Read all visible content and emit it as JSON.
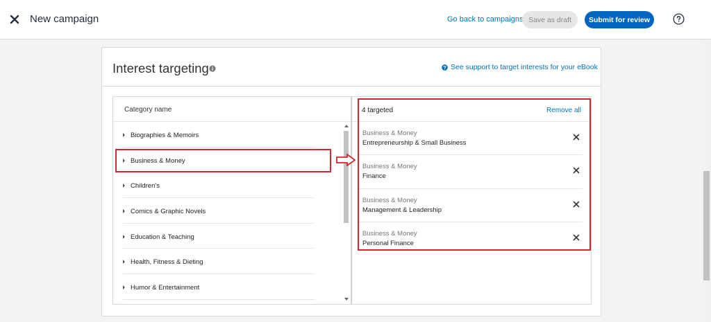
{
  "header": {
    "title": "New campaign",
    "back_link": "Go back to campaigns",
    "save_draft": "Save as draft",
    "submit": "Submit for review"
  },
  "card": {
    "title": "Interest targeting",
    "support_link": "See support to target interests for your eBook"
  },
  "categories": {
    "header": "Category name",
    "items": [
      "Biographies & Memoirs",
      "Business & Money",
      "Children's",
      "Comics & Graphic Novels",
      "Education & Teaching",
      "Health, Fitness & Dieting",
      "Humor & Entertainment"
    ]
  },
  "targeted": {
    "count_label": "4 targeted",
    "remove_all": "Remove all",
    "items": [
      {
        "parent": "Business & Money",
        "name": "Entrepreneurship & Small Business"
      },
      {
        "parent": "Business & Money",
        "name": "Finance"
      },
      {
        "parent": "Business & Money",
        "name": "Management & Leadership"
      },
      {
        "parent": "Business & Money",
        "name": "Personal Finance"
      }
    ]
  },
  "colors": {
    "link": "#0073bb",
    "primary_button": "#0066c0",
    "highlight": "#d6262d"
  }
}
